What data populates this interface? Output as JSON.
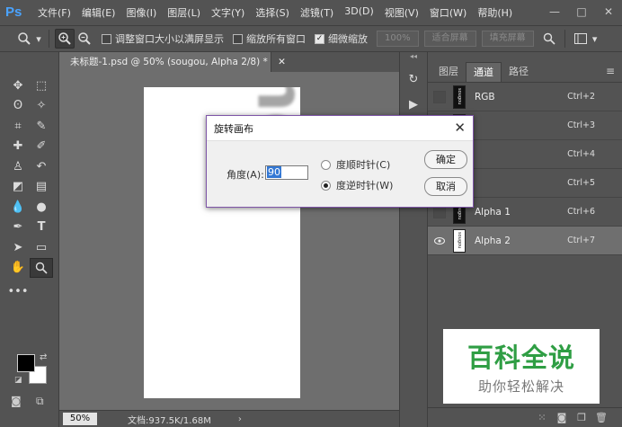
{
  "app": {
    "logo": "Ps"
  },
  "menu": [
    "文件(F)",
    "编辑(E)",
    "图像(I)",
    "图层(L)",
    "文字(Y)",
    "选择(S)",
    "滤镜(T)",
    "3D(D)",
    "视图(V)",
    "窗口(W)",
    "帮助(H)"
  ],
  "options": {
    "resize_windows": "调整窗口大小以满屏显示",
    "zoom_all": "缩放所有窗口",
    "scrubby_zoom": "细微缩放",
    "btn_100": "100%",
    "btn_fit": "适合屏幕",
    "btn_fill": "填充屏幕"
  },
  "document": {
    "tab_title": "未标题-1.psd @ 50% (sougou, Alpha 2/8) *",
    "canvas_text": "sougou",
    "zoom": "50%",
    "doc_info": "文档:937.5K/1.68M"
  },
  "panel": {
    "tabs": [
      "图层",
      "通道",
      "路径"
    ],
    "channels": [
      {
        "name": "RGB",
        "key": "Ctrl+2"
      },
      {
        "name": "",
        "key": "Ctrl+3"
      },
      {
        "name": "",
        "key": "Ctrl+4"
      },
      {
        "name": "",
        "key": "Ctrl+5"
      },
      {
        "name": "Alpha 1",
        "key": "Ctrl+6"
      },
      {
        "name": "Alpha 2",
        "key": "Ctrl+7"
      }
    ]
  },
  "dialog": {
    "title": "旋转画布",
    "angle_label": "角度(A):",
    "angle_value": "90",
    "cw_label": "度顺时针(C)",
    "ccw_label": "度逆时针(W)",
    "ok": "确定",
    "cancel": "取消"
  },
  "watermark": {
    "title": "百科全说",
    "subtitle": "助你轻松解决"
  }
}
